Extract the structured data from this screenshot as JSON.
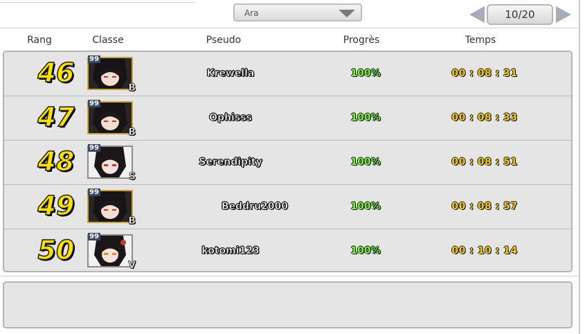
{
  "filter": {
    "selected": "Ara"
  },
  "pager": {
    "label": "10/20"
  },
  "columns": {
    "rank": "Rang",
    "class": "Classe",
    "name": "Pseudo",
    "progress": "Progrès",
    "time": "Temps"
  },
  "rows": [
    {
      "rank": "46",
      "level": "99",
      "class_letter": "B",
      "name": "Krewella",
      "progress": "100%",
      "time": "00 : 08 : 31"
    },
    {
      "rank": "47",
      "level": "99",
      "class_letter": "B",
      "name": "Ophisss",
      "progress": "100%",
      "time": "00 : 08 : 33"
    },
    {
      "rank": "48",
      "level": "99",
      "class_letter": "S",
      "name": "Serendipity",
      "progress": "100%",
      "time": "00 : 08 : 51"
    },
    {
      "rank": "49",
      "level": "99",
      "class_letter": "B",
      "name": "Beddru2000",
      "progress": "100%",
      "time": "00 : 08 : 57"
    },
    {
      "rank": "50",
      "level": "99",
      "class_letter": "V",
      "name": "kotomi123",
      "progress": "100%",
      "time": "00 : 10 : 14"
    }
  ],
  "colors": {
    "rank": "#ffe000",
    "progress": "#7dff3a",
    "time": "#ffd21a",
    "panel": "#e5e5e5"
  },
  "icons": {
    "prev": "triangle-left-icon",
    "next": "triangle-right-icon",
    "dropdown": "chevron-down-icon"
  }
}
